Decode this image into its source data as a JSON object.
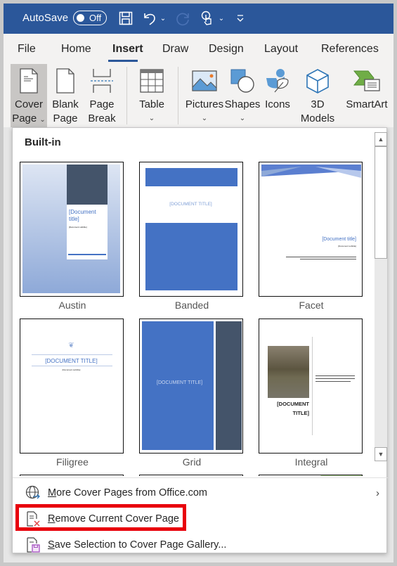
{
  "titlebar": {
    "autosave_label": "AutoSave",
    "autosave_state": "Off",
    "quick_access": [
      "save-icon",
      "undo-icon",
      "undo-dropdown",
      "redo-icon",
      "touch-mode-icon",
      "touch-dropdown",
      "customize-qat-icon"
    ],
    "background": "#2b579a"
  },
  "tabs": [
    {
      "label": "File",
      "active": false
    },
    {
      "label": "Home",
      "active": false
    },
    {
      "label": "Insert",
      "active": true
    },
    {
      "label": "Draw",
      "active": false
    },
    {
      "label": "Design",
      "active": false
    },
    {
      "label": "Layout",
      "active": false
    },
    {
      "label": "References",
      "active": false
    }
  ],
  "ribbon": {
    "cover_page": {
      "line1": "Cover",
      "line2": "Page",
      "chevron": "⌄"
    },
    "blank_page": {
      "line1": "Blank",
      "line2": "Page"
    },
    "page_break": {
      "line1": "Page",
      "line2": "Break"
    },
    "table": {
      "line1": "Table",
      "chevron": "⌄"
    },
    "pictures": {
      "line1": "Pictures",
      "chevron": "⌄"
    },
    "shapes": {
      "line1": "Shapes",
      "chevron": "⌄"
    },
    "icons": {
      "line1": "Icons"
    },
    "models_3d": {
      "line1": "3D",
      "line2": "Models",
      "chevron": "⌄"
    },
    "smartart": {
      "line1": "SmartArt"
    }
  },
  "dropdown": {
    "section_label": "Built-in",
    "templates": [
      {
        "name": "Austin",
        "title": "[Document title]",
        "subtitle": "[Document subtitle]"
      },
      {
        "name": "Banded",
        "title": "[DOCUMENT TITLE]"
      },
      {
        "name": "Facet",
        "title": "[Document title]",
        "subtitle": "[Document subtitle]"
      },
      {
        "name": "Filigree",
        "title": "[DOCUMENT TITLE]",
        "subtitle": "[Document subtitle]"
      },
      {
        "name": "Grid",
        "title": "[DOCUMENT TITLE]"
      },
      {
        "name": "Integral",
        "title": "[DOCUMENT TITLE]",
        "subtitle": "[Document subtitle]"
      }
    ],
    "menu_items": [
      {
        "accel": "M",
        "rest": "ore Cover Pages from Office.com",
        "icon": "globe-icon",
        "has_submenu": true
      },
      {
        "accel": "R",
        "rest": "emove Current Cover Page",
        "icon": "remove-page-icon",
        "highlighted": true
      },
      {
        "accel": "S",
        "rest": "ave Selection to Cover Page Gallery...",
        "icon": "save-to-gallery-icon"
      }
    ],
    "submenu_arrow": "›",
    "highlight_color": "#e8000b"
  }
}
